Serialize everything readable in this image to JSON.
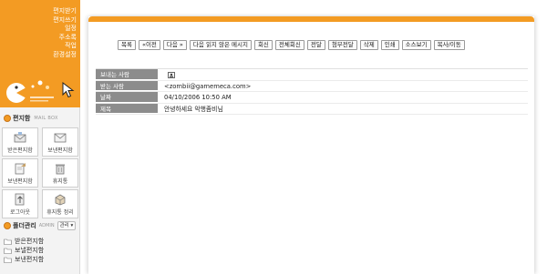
{
  "sidebar": {
    "nav_items": [
      "편지받기",
      "편지쓰기",
      "일정",
      "주소록",
      "작업",
      "환경설정"
    ],
    "mailbox": {
      "title": "편지함",
      "subtitle": "MAIL BOX",
      "buttons": [
        {
          "label": "받은편지함",
          "icon": "inbox-icon"
        },
        {
          "label": "보낸편지함",
          "icon": "sent-icon"
        },
        {
          "label": "보낸편지함",
          "icon": "draft-icon"
        },
        {
          "label": "휴지통",
          "icon": "trash-icon"
        },
        {
          "label": "로그아웃",
          "icon": "logout-icon"
        },
        {
          "label": "휴지통 정리",
          "icon": "empty-trash-icon"
        }
      ]
    },
    "folders": {
      "title": "폴더관리",
      "subtitle": "ADMIN",
      "manage_label": "관리 ▾",
      "items": [
        "받은편지함",
        "보낼편지함",
        "보낸편지함"
      ]
    }
  },
  "toolbar": {
    "buttons": [
      "목록",
      "«이전",
      "다음 »",
      "다음 읽지 않은 메시지",
      "회신",
      "전체회신",
      "전달",
      "첨부전달",
      "삭제",
      "인쇄",
      "소스보기",
      "복사/이동"
    ]
  },
  "message": {
    "headers": [
      {
        "label": "보내는 사람",
        "value": "",
        "blurred": true
      },
      {
        "label": "받는 사람",
        "value": "<zombii@gamemeca.com>",
        "blurred": false
      },
      {
        "label": "날짜",
        "value": "04/10/2006 10:50 AM",
        "blurred": false
      },
      {
        "label": "제목",
        "value": "안녕하세요 악행좀비님",
        "blurred": false
      }
    ],
    "body_lines": [
      "",
      "",
      "",
      "",
      "",
      "",
      "",
      "",
      "",
      "",
      "",
      "",
      "",
      ""
    ]
  },
  "colors": {
    "accent": "#f39b23",
    "header_label_bg": "#8c8c8c"
  }
}
